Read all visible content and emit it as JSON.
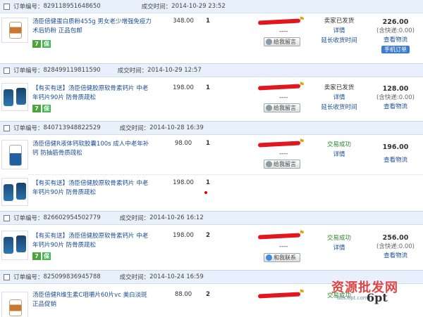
{
  "labels": {
    "order_no": "订单编号：",
    "deal_time": "成交时间：",
    "details": "详情",
    "extend": "延长收货时间",
    "view_logistics": "查看物流",
    "leave_msg": "给我留言",
    "contact_me": "和我联系",
    "dashes": "----",
    "ship_fee": "(含快递:0.00)",
    "mobile_order": "手机订单"
  },
  "orders": [
    {
      "no": "829118951648650",
      "time": "2014-10-29 23:52",
      "status": "卖家已发货",
      "total": "226.00",
      "products": [
        {
          "title": "汤臣倍健蛋白质粉455g 男女老少增强免疫力 术后奶粉 正品包邮",
          "price": "348.00",
          "qty": "1"
        }
      ]
    },
    {
      "no": "828499119811590",
      "time": "2014-10-29 12:57",
      "status": "卖家已发货",
      "total": "128.00",
      "products": [
        {
          "title": "【有买有送】汤臣倍健胶原软骨素钙片 中老年钙片90片 防骨质疏松",
          "price": "198.00",
          "qty": "1"
        }
      ]
    },
    {
      "no": "840713948822529",
      "time": "2014-10-28 16:39",
      "status": "交易成功",
      "total": "196.00",
      "products": [
        {
          "title": "汤臣倍健R液体钙软胶囊100s 成人中老年补钙 防抽筋骨质疏松",
          "price": "98.00",
          "qty": "1"
        },
        {
          "title": "【有买有送】汤臣倍健胶原软骨素钙片 中老年钙片90片 防骨质疏松",
          "price": "198.00",
          "qty": "1"
        }
      ]
    },
    {
      "no": "826602954502779",
      "time": "2014-10-26 16:12",
      "status": "交易成功",
      "total": "256.00",
      "products": [
        {
          "title": "【有买有送】汤臣倍健胶原软骨素钙片 中老年钙片90片 防骨质疏松",
          "price": "198.00",
          "qty": "2"
        }
      ]
    },
    {
      "no": "825099836945788",
      "time": "2014-10-24 16:59",
      "status": "交易成功",
      "total": "",
      "products": [
        {
          "title": "汤臣倍健R维生素C咀嚼片60片vc 美白淡斑 正品促销",
          "price": "88.00",
          "qty": "2"
        }
      ]
    }
  ],
  "watermark": {
    "text": "资源批发网",
    "logo": "6pt",
    "url": "bbs.6pt.com"
  }
}
